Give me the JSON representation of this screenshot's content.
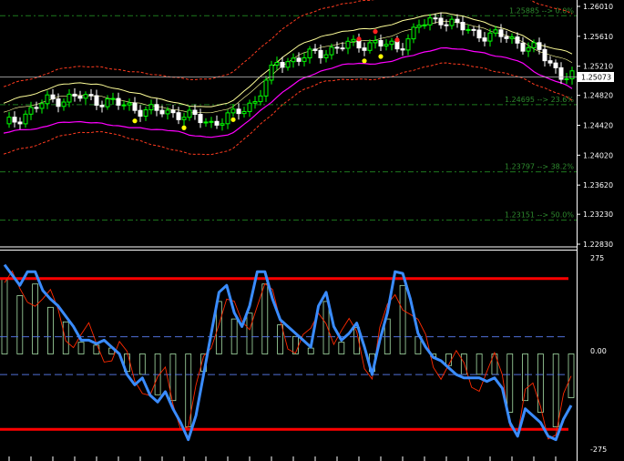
{
  "colors": {
    "background": "#000000",
    "bull_candle": "#00ff00",
    "bear_candle": "#ffffff",
    "fib_line": "#1e7a1e",
    "fib_text": "#2e8b2e",
    "band_upper": "#ffff99",
    "band_lower": "#ff00ff",
    "envelope": "#ff3b1f",
    "osc_line": "#3a8cff",
    "osc_signal": "#ff2a00",
    "osc_hist": "#a8e0a8",
    "osc_limit": "#ff0000",
    "osc_level": "#4f6fd6",
    "axis": "#ffffff"
  },
  "main_pane": {
    "price_ticks": [
      "1.26010",
      "1.25610",
      "1.25210",
      "1.24820",
      "1.24420",
      "1.24020",
      "1.23620",
      "1.23230",
      "1.22830"
    ],
    "current_price": "1.25073",
    "fib_levels": [
      {
        "price": 1.25885,
        "label": "1.25885 --> 0.0%"
      },
      {
        "price": 1.24695,
        "label": "1.24695 --> 23.6%"
      },
      {
        "price": 1.23797,
        "label": "1.23797 --> 38.2%"
      },
      {
        "price": 1.23151,
        "label": "1.23151 --> 50.0%"
      }
    ]
  },
  "osc_pane": {
    "ticks": [
      "275",
      "0.00",
      "-275"
    ],
    "range": [
      -275,
      275
    ],
    "upper_limit": 220,
    "lower_limit": -220,
    "level_up": 50,
    "level_down": -60,
    "cci_values": [
      260,
      230,
      200,
      240,
      240,
      185,
      160,
      140,
      110,
      80,
      40,
      40,
      30,
      40,
      20,
      0,
      -60,
      -90,
      -70,
      -120,
      -140,
      -110,
      -160,
      -200,
      -250,
      -180,
      -60,
      60,
      180,
      200,
      120,
      80,
      140,
      240,
      240,
      160,
      100,
      80,
      60,
      40,
      20,
      140,
      180,
      80,
      40,
      60,
      90,
      20,
      -60,
      40,
      120,
      240,
      235,
      160,
      60,
      20,
      -10,
      -20,
      -40,
      -60,
      -70,
      -70,
      -70,
      -80,
      -70,
      -100,
      -200,
      -240,
      -160,
      -180,
      -200,
      -240,
      -250,
      -190,
      -150
    ]
  }
}
